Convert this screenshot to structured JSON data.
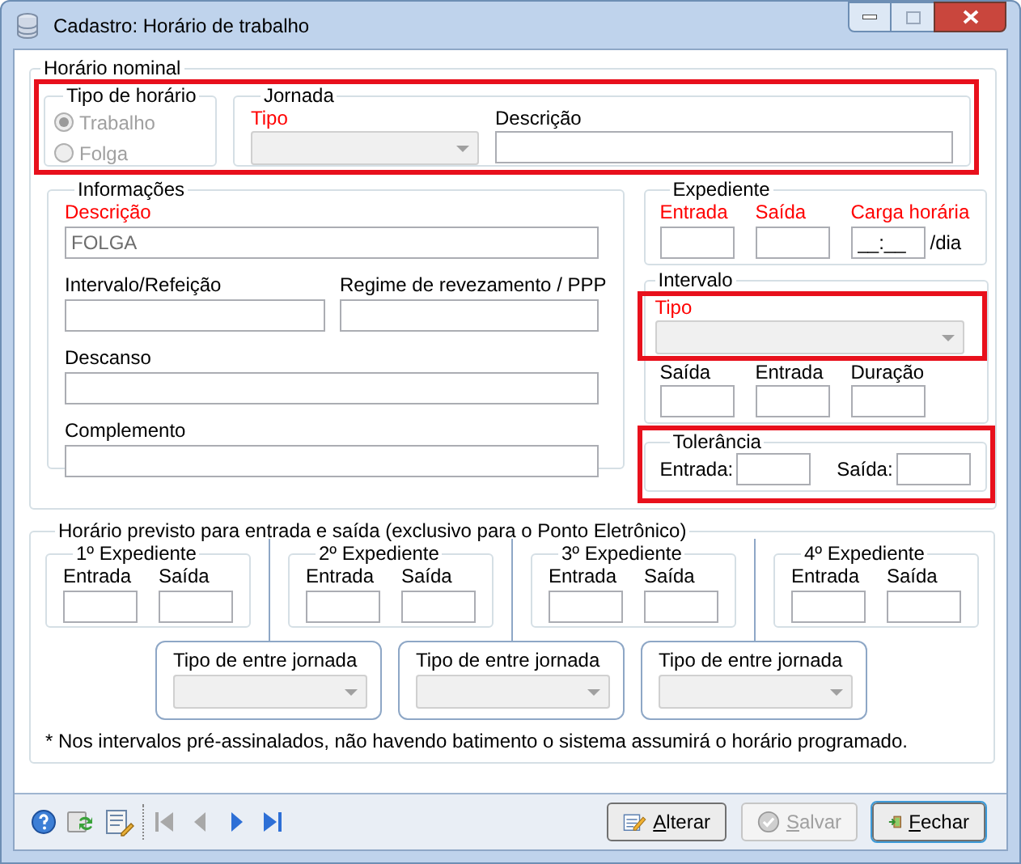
{
  "window": {
    "title": "Cadastro: Horário de trabalho"
  },
  "horario_nominal": {
    "title": "Horário nominal",
    "top_row": {
      "highlighted": true,
      "tipo_de_horario": {
        "title": "Tipo de horário",
        "options": [
          {
            "label": "Trabalho",
            "selected": true,
            "disabled": true
          },
          {
            "label": "Folga",
            "selected": false,
            "disabled": true
          }
        ]
      },
      "jornada": {
        "title": "Jornada",
        "tipo": {
          "label": "Tipo",
          "required": true,
          "disabled": true
        },
        "descricao": {
          "label": "Descrição",
          "required": false
        }
      }
    },
    "informacoes": {
      "title": "Informações",
      "descricao": {
        "label": "Descrição",
        "required": true,
        "value": "FOLGA",
        "disabled": true
      },
      "intervalo_refeicao": {
        "label": "Intervalo/Refeição",
        "required": false
      },
      "regime": {
        "label": "Regime de revezamento / PPP",
        "required": false
      },
      "descanso": {
        "label": "Descanso",
        "required": false
      },
      "complemento": {
        "label": "Complemento",
        "required": false
      }
    },
    "expediente": {
      "title": "Expediente",
      "fields": [
        {
          "label": "Entrada",
          "required": true
        },
        {
          "label": "Saída",
          "required": true
        },
        {
          "label": "Carga horária",
          "required": true,
          "value": "__:__",
          "suffix": "/dia"
        }
      ]
    },
    "intervalo": {
      "title": "Intervalo",
      "tipo": {
        "label": "Tipo",
        "required": true,
        "disabled": true,
        "highlighted": true
      },
      "fields": [
        {
          "label": "Saída",
          "required": false
        },
        {
          "label": "Entrada",
          "required": false
        },
        {
          "label": "Duração",
          "required": false
        }
      ]
    },
    "tolerancia": {
      "title": "Tolerância",
      "highlighted": true,
      "fields": [
        {
          "label": "Entrada:"
        },
        {
          "label": "Saída:"
        }
      ]
    }
  },
  "horario_previsto": {
    "title": "Horário previsto para entrada e saída  (exclusivo para o Ponto Eletrônico)",
    "expedientes": [
      {
        "title": "1º Expediente",
        "fields": [
          "Entrada",
          "Saída"
        ]
      },
      {
        "title": "2º Expediente",
        "fields": [
          "Entrada",
          "Saída"
        ]
      },
      {
        "title": "3º Expediente",
        "fields": [
          "Entrada",
          "Saída"
        ]
      },
      {
        "title": "4º Expediente",
        "fields": [
          "Entrada",
          "Saída"
        ]
      }
    ],
    "entre_jornadas": [
      {
        "label": "Tipo de entre jornada",
        "disabled": true
      },
      {
        "label": "Tipo de entre jornada",
        "disabled": true
      },
      {
        "label": "Tipo de entre jornada",
        "disabled": true
      }
    ],
    "note": "* Nos intervalos pré-assinalados, não havendo batimento o sistema assumirá o horário programado."
  },
  "toolbar": {
    "icons": [
      {
        "kind": "help"
      },
      {
        "kind": "refresh"
      },
      {
        "kind": "edit"
      }
    ],
    "nav": [
      {
        "kind": "first",
        "disabled": true
      },
      {
        "kind": "prev",
        "disabled": true
      },
      {
        "kind": "next",
        "disabled": false
      },
      {
        "kind": "last",
        "disabled": false
      }
    ],
    "buttons": [
      {
        "kind": "edit",
        "label": "Alterar",
        "disabled": false,
        "default": false
      },
      {
        "kind": "save",
        "label": "Salvar",
        "disabled": true,
        "default": false
      },
      {
        "kind": "close",
        "label": "Fechar",
        "disabled": false,
        "default": true
      }
    ]
  }
}
